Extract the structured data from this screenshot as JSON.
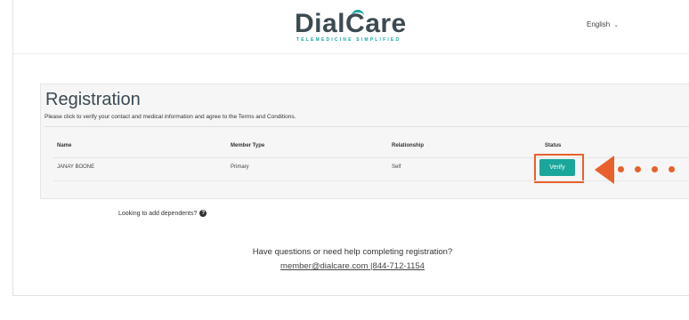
{
  "header": {
    "logo_word_1": "Dial",
    "logo_word_2": "Care",
    "logo_tagline": "TELEMEDICINE SIMPLIFIED",
    "language": "English"
  },
  "registration": {
    "title": "Registration",
    "subtitle": "Please click to verify your contact and medical information and agree to the Terms and Conditions.",
    "columns": [
      "Name",
      "Member Type",
      "Relationship",
      "Status"
    ],
    "rows": [
      {
        "name": "JANAY BOONE",
        "member_type": "Primary",
        "relationship": "Self",
        "status_button": "Verify"
      }
    ]
  },
  "dependents_prompt": "Looking to add dependents?",
  "help": {
    "question": "Have questions or need help completing registration?",
    "email": "member@dialcare.com",
    "phone": "844-712-1154",
    "separator": " |"
  },
  "colors": {
    "accent": "#1aa69a",
    "highlight": "#e8612c",
    "heading": "#3a4a55"
  },
  "icons": {
    "language_dropdown": "chevron-down-icon",
    "dependents_help": "question-circle-icon",
    "callout": "arrow-left-icon"
  }
}
